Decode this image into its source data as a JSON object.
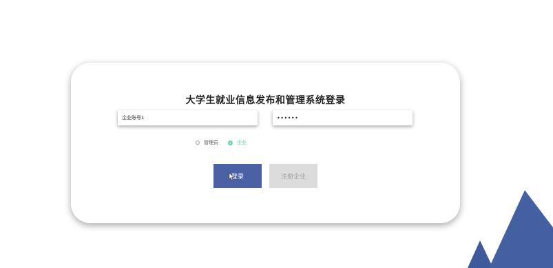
{
  "login_form": {
    "title": "大学生就业信息发布和管理系统登录",
    "account_value": "企业账号1",
    "password_value": "••••••",
    "roles": [
      {
        "label": "管理员",
        "checked": false
      },
      {
        "label": "企业",
        "checked": true
      }
    ],
    "login_label": "登录",
    "register_label": "注册企业"
  },
  "colors": {
    "primary": "#4a61a3",
    "mountain": "#3f5a9c",
    "checked_radio": "#5fd6a5",
    "disabled_button": "#dcdcdc"
  }
}
